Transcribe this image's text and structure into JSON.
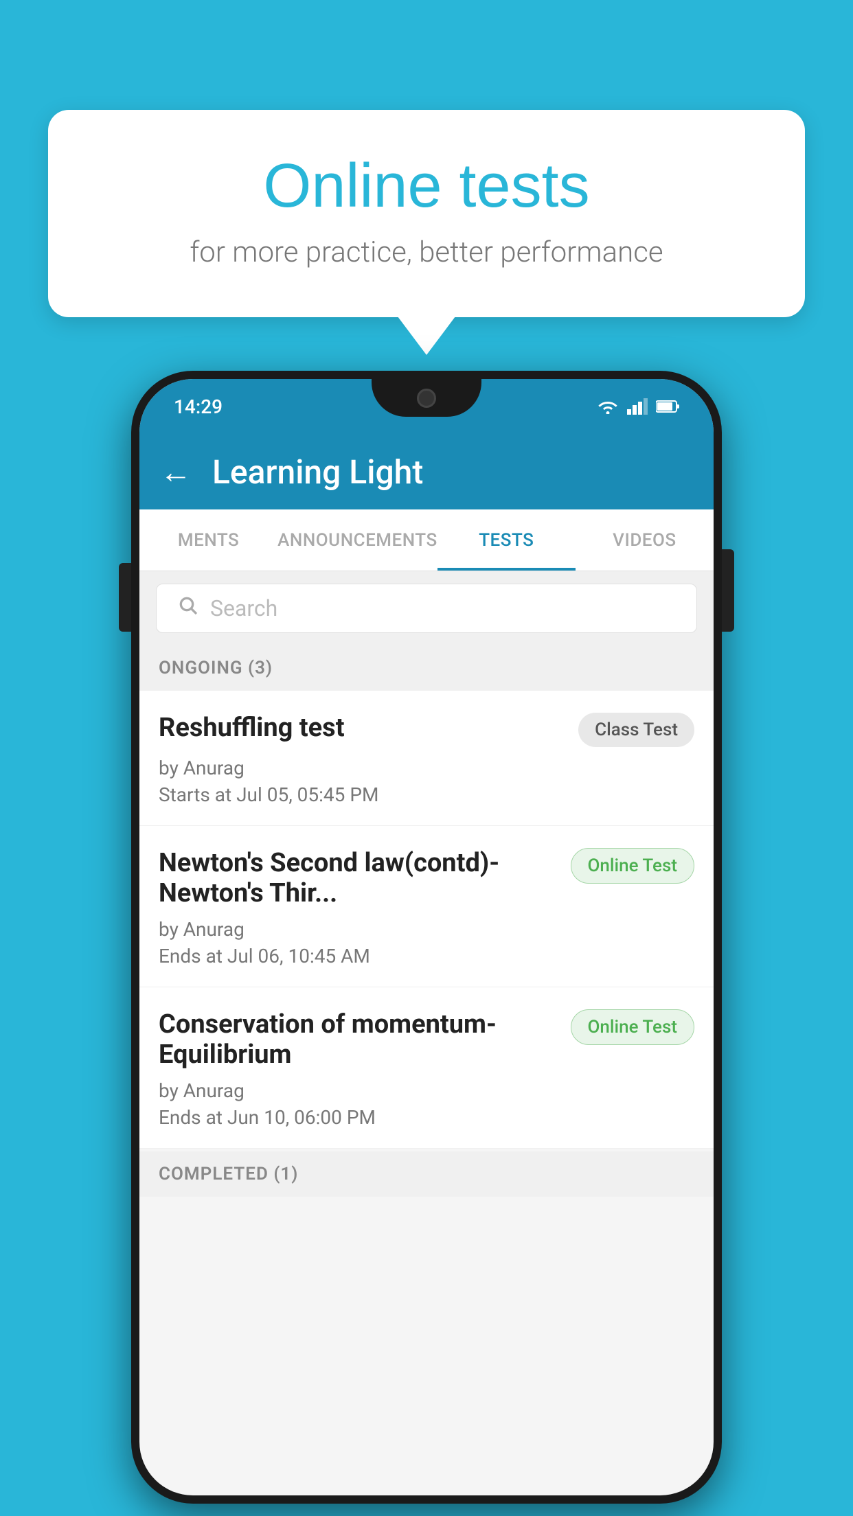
{
  "background_color": "#29b6d8",
  "bubble": {
    "title": "Online tests",
    "subtitle": "for more practice, better performance"
  },
  "phone": {
    "status_bar": {
      "time": "14:29",
      "wifi": "▾",
      "signal": "signal",
      "battery": "battery"
    },
    "app_bar": {
      "title": "Learning Light",
      "back_label": "←"
    },
    "tabs": [
      {
        "label": "MENTS",
        "active": false
      },
      {
        "label": "ANNOUNCEMENTS",
        "active": false
      },
      {
        "label": "TESTS",
        "active": true
      },
      {
        "label": "VIDEOS",
        "active": false
      }
    ],
    "search": {
      "placeholder": "Search"
    },
    "sections": [
      {
        "label": "ONGOING (3)",
        "items": [
          {
            "title": "Reshuffling test",
            "badge": "Class Test",
            "badge_type": "class",
            "author": "by Anurag",
            "time_label": "Starts at",
            "time_value": "Jul 05, 05:45 PM"
          },
          {
            "title": "Newton's Second law(contd)-Newton's Thir...",
            "badge": "Online Test",
            "badge_type": "online",
            "author": "by Anurag",
            "time_label": "Ends at",
            "time_value": "Jul 06, 10:45 AM"
          },
          {
            "title": "Conservation of momentum-Equilibrium",
            "badge": "Online Test",
            "badge_type": "online",
            "author": "by Anurag",
            "time_label": "Ends at",
            "time_value": "Jun 10, 06:00 PM"
          }
        ]
      }
    ],
    "completed_section_label": "COMPLETED (1)"
  }
}
